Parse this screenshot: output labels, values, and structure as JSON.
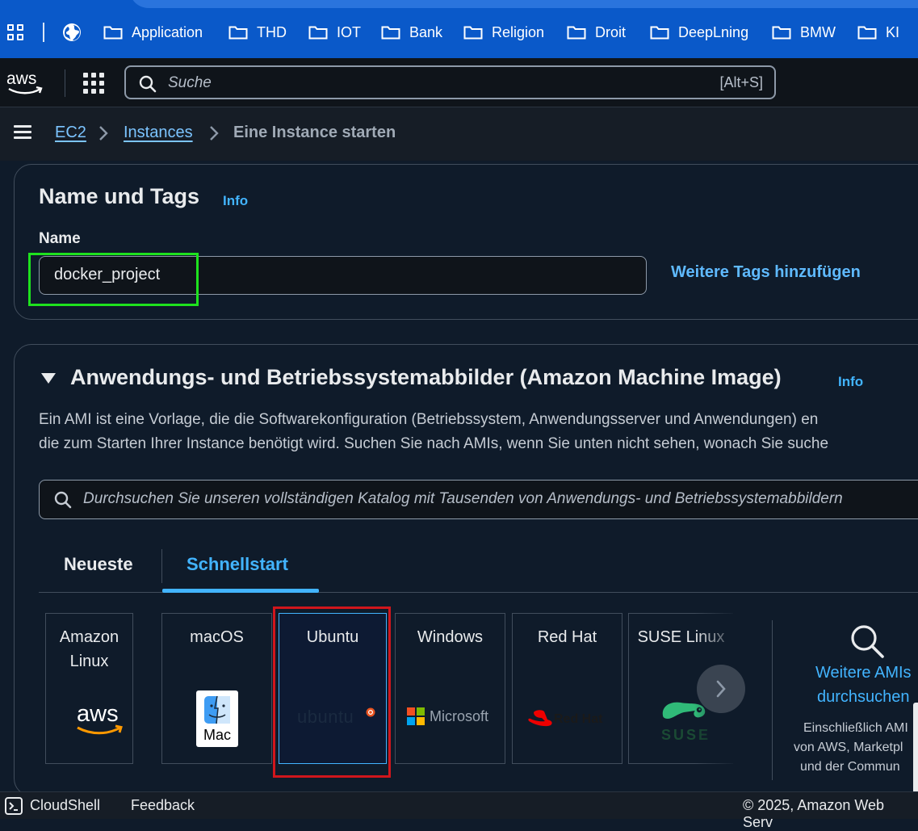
{
  "bookmarks": {
    "items": [
      "Application",
      "THD",
      "IOT",
      "Bank",
      "Religion",
      "Droit",
      "DeepLning",
      "BMW",
      "KI"
    ]
  },
  "header": {
    "search_placeholder": "Suche",
    "search_shortcut": "[Alt+S]"
  },
  "breadcrumb": {
    "items": [
      "EC2",
      "Instances",
      "Eine Instance starten"
    ]
  },
  "name_tags": {
    "title": "Name und Tags",
    "info": "Info",
    "name_label": "Name",
    "name_value": "docker_project",
    "add_tags": "Weitere Tags hinzufügen"
  },
  "ami": {
    "title": "Anwendungs- und Betriebssystemabbilder (Amazon Machine Image)",
    "info": "Info",
    "description_line1": "Ein AMI ist eine Vorlage, die die Softwarekonfiguration (Betriebssystem, Anwendungsserver und Anwendungen) en",
    "description_line2": "die zum Starten Ihrer Instance benötigt wird. Suchen Sie nach AMIs, wenn Sie unten nicht sehen, wonach Sie suche",
    "search_placeholder": "Durchsuchen Sie unseren vollständigen Katalog mit Tausenden von Anwendungs- und Betriebssystemabbildern",
    "tabs": [
      "Neueste",
      "Schnellstart"
    ],
    "active_tab": "Schnellstart",
    "tiles": [
      {
        "name_line1": "Amazon",
        "name_line2": "Linux",
        "logo": "aws"
      },
      {
        "name_line1": "macOS",
        "name_line2": "",
        "logo": "Mac"
      },
      {
        "name_line1": "Ubuntu",
        "name_line2": "",
        "logo": "ubuntu"
      },
      {
        "name_line1": "Windows",
        "name_line2": "",
        "logo": "Microsoft"
      },
      {
        "name_line1": "Red Hat",
        "name_line2": "",
        "logo": "Red Hat"
      },
      {
        "name_line1": "SUSE Linux",
        "name_line2": "",
        "logo": "SUSE"
      }
    ],
    "selected_tile": "Ubuntu",
    "more_link_line1": "Weitere AMIs",
    "more_link_line2": "durchsuchen",
    "more_sub_line1": "Einschließlich AMI",
    "more_sub_line2": "von AWS, Marketpl",
    "more_sub_line3": "und der Commun"
  },
  "footer": {
    "cloudshell": "CloudShell",
    "feedback": "Feedback",
    "copyright": "© 2025, Amazon Web Serv"
  },
  "colors": {
    "bookmark_bar": "#0a59c9",
    "link": "#42b4ff",
    "highlight_green": "#1ee21e",
    "highlight_red": "#d0161c"
  }
}
